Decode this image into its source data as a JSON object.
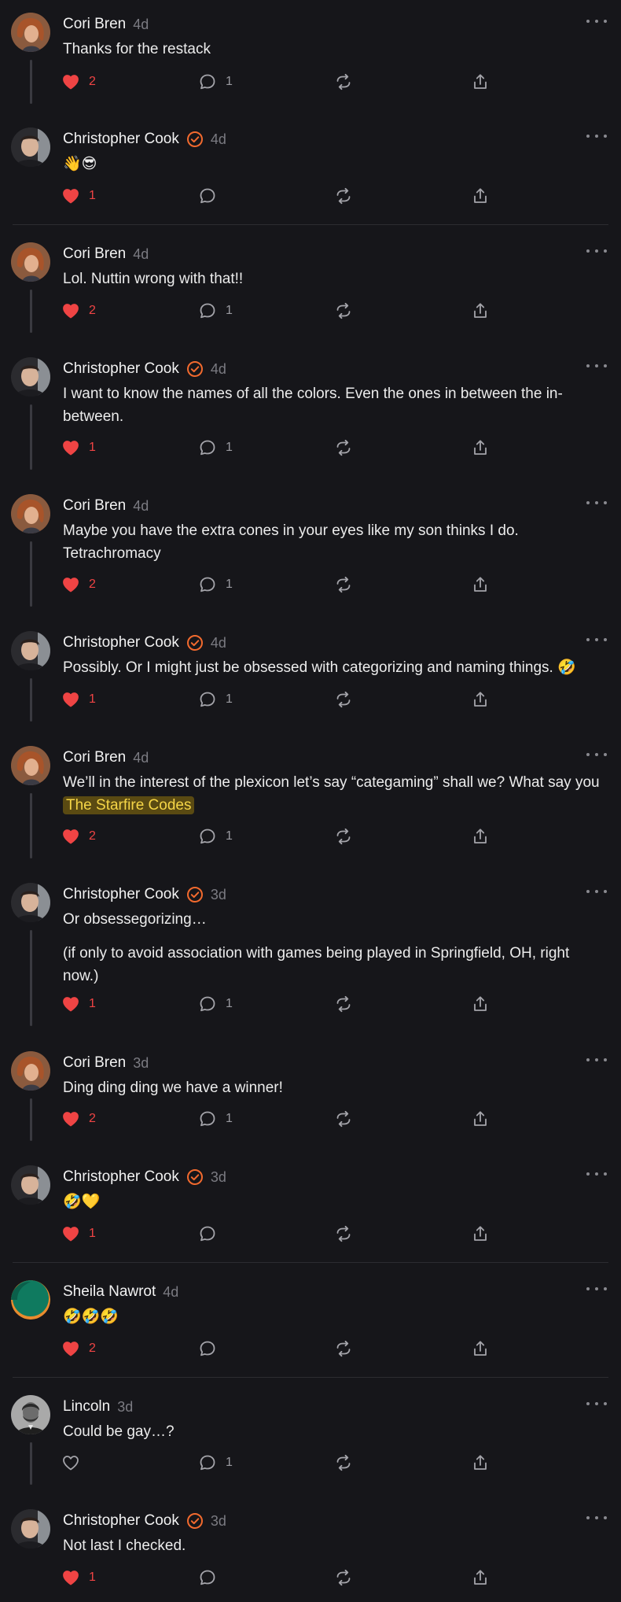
{
  "colors": {
    "background": "#16161a",
    "like_active": "#ef4444",
    "verified": "#f26a2e",
    "mention_bg": "#5a4a12",
    "mention_text": "#f5d547",
    "muted": "#7b7b82"
  },
  "icons": {
    "like": "heart-icon",
    "reply": "speech-bubble-icon",
    "restack": "repeat-arrows-icon",
    "share": "share-upload-icon",
    "more": "ellipsis-icon",
    "verified": "check-circle-icon"
  },
  "comments": [
    {
      "author": "Cori Bren",
      "time": "4d",
      "verified": false,
      "avatar": "cori",
      "body": [
        "Thanks for the restack"
      ],
      "likes": "2",
      "liked": true,
      "replies": "1"
    },
    {
      "author": "Christopher Cook",
      "time": "4d",
      "verified": true,
      "avatar": "chris",
      "body": [
        "👋😎"
      ],
      "likes": "1",
      "liked": true,
      "replies": ""
    },
    {
      "author": "Cori Bren",
      "time": "4d",
      "verified": false,
      "avatar": "cori",
      "body": [
        "Lol. Nuttin wrong with that!!"
      ],
      "likes": "2",
      "liked": true,
      "replies": "1"
    },
    {
      "author": "Christopher Cook",
      "time": "4d",
      "verified": true,
      "avatar": "chris",
      "body": [
        "I want to know the names of all the colors. Even the ones in between the in-between."
      ],
      "likes": "1",
      "liked": true,
      "replies": "1"
    },
    {
      "author": "Cori Bren",
      "time": "4d",
      "verified": false,
      "avatar": "cori",
      "body": [
        "Maybe you have the extra cones in your eyes like my son thinks I do. Tetrachromacy"
      ],
      "likes": "2",
      "liked": true,
      "replies": "1"
    },
    {
      "author": "Christopher Cook",
      "time": "4d",
      "verified": true,
      "avatar": "chris",
      "body": [
        "Possibly. Or I might just be obsessed with categorizing and naming things. 🤣"
      ],
      "likes": "1",
      "liked": true,
      "replies": "1"
    },
    {
      "author": "Cori Bren",
      "time": "4d",
      "verified": false,
      "avatar": "cori",
      "body": [
        "We’ll in the interest of the plexicon let’s say “categaming” shall we? What say you"
      ],
      "mention": "The Starfire Codes",
      "likes": "2",
      "liked": true,
      "replies": "1"
    },
    {
      "author": "Christopher Cook",
      "time": "3d",
      "verified": true,
      "avatar": "chris",
      "body": [
        "Or obsessegorizing…",
        "(if only to avoid association with games being played in Springfield, OH, right now.)"
      ],
      "likes": "1",
      "liked": true,
      "replies": "1"
    },
    {
      "author": "Cori Bren",
      "time": "3d",
      "verified": false,
      "avatar": "cori",
      "body": [
        "Ding ding ding we have a winner!"
      ],
      "likes": "2",
      "liked": true,
      "replies": "1"
    },
    {
      "author": "Christopher Cook",
      "time": "3d",
      "verified": true,
      "avatar": "chris",
      "body": [
        "🤣💛"
      ],
      "likes": "1",
      "liked": true,
      "replies": ""
    },
    {
      "author": "Sheila Nawrot",
      "time": "4d",
      "verified": false,
      "avatar": "sheila",
      "body": [
        "🤣🤣🤣"
      ],
      "likes": "2",
      "liked": true,
      "replies": ""
    },
    {
      "author": "Lincoln",
      "time": "3d",
      "verified": false,
      "avatar": "lincoln",
      "body": [
        "Could be gay…?"
      ],
      "likes": "",
      "liked": false,
      "replies": "1"
    },
    {
      "author": "Christopher Cook",
      "time": "3d",
      "verified": true,
      "avatar": "chris",
      "body": [
        "Not last I checked."
      ],
      "likes": "1",
      "liked": true,
      "replies": ""
    }
  ]
}
